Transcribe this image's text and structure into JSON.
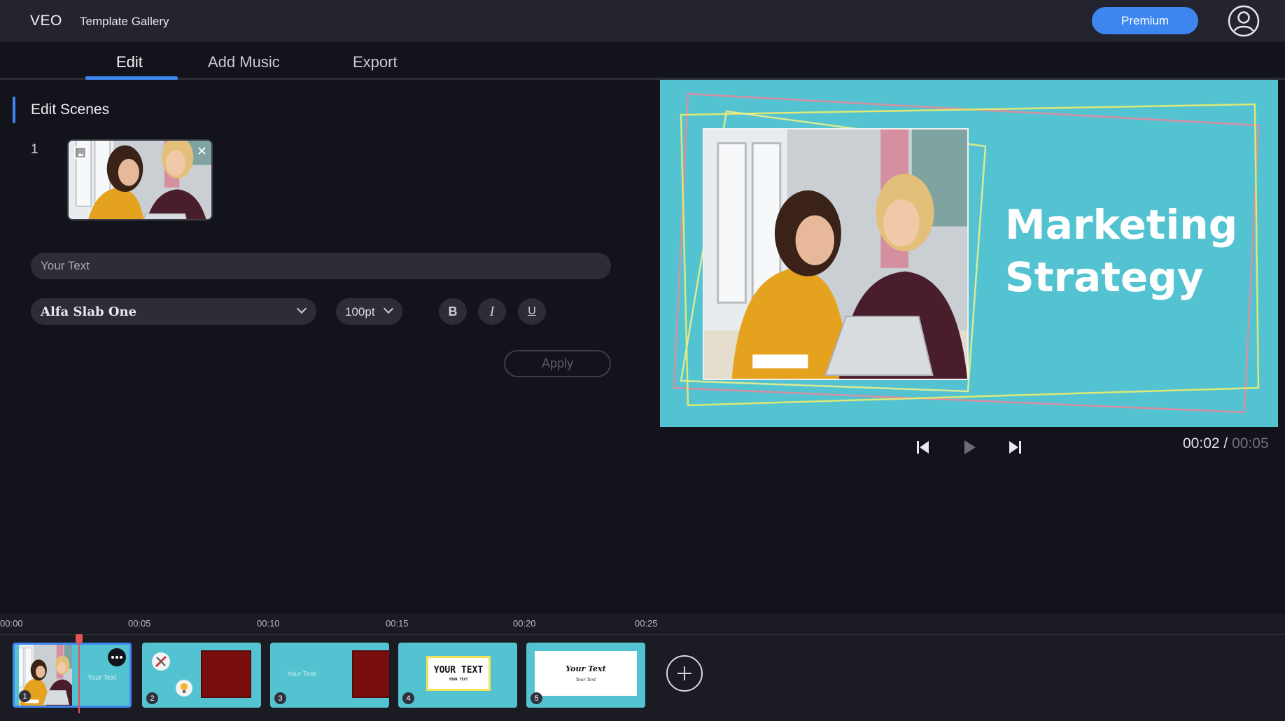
{
  "app": {
    "logo": "VEO",
    "gallery_link": "Template Gallery",
    "premium_label": "Premium"
  },
  "tabs": [
    {
      "label": "Edit",
      "active": true
    },
    {
      "label": "Add Music",
      "active": false
    },
    {
      "label": "Export",
      "active": false
    }
  ],
  "editor": {
    "section_title": "Edit Scenes",
    "scene_number": "1",
    "text_placeholder": "Your Text",
    "font_value": "Alfa Slab One",
    "size_value": "100pt",
    "format": {
      "bold": "B",
      "italic": "I",
      "underline": "U"
    },
    "apply_label": "Apply"
  },
  "preview": {
    "title_line1": "Marketing",
    "title_line2": "Strategy",
    "background": "#54c3d1"
  },
  "player": {
    "current_time": "00:02",
    "separator": " / ",
    "total_time": "00:05"
  },
  "timeline": {
    "ticks": [
      "00:00",
      "00:05",
      "00:10",
      "00:15",
      "00:20",
      "00:25"
    ],
    "clips": [
      {
        "number": "1",
        "text": "Your Text",
        "active": true
      },
      {
        "number": "2",
        "active": false
      },
      {
        "number": "3",
        "text": "Your Text",
        "active": false
      },
      {
        "number": "4",
        "big_text": "YOUR TEXT",
        "small_text": "YOUR TEXT",
        "active": false
      },
      {
        "number": "5",
        "big_text": "Your Text",
        "small_text": "Your Text",
        "active": false
      }
    ]
  },
  "colors": {
    "accent": "#3d86f0",
    "background": "#13141b",
    "playhead": "#e35555"
  }
}
